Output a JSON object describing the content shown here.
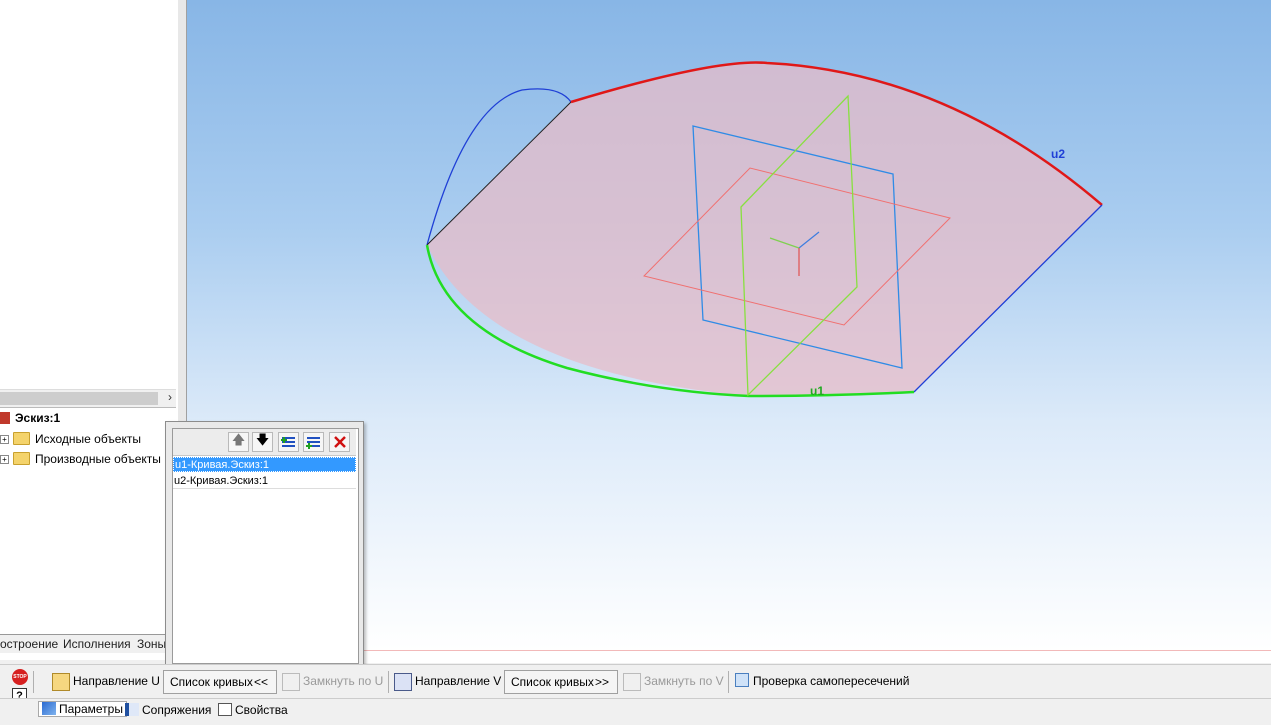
{
  "tree": {
    "root": "Эскиз:1",
    "items": [
      "Исходные объекты",
      "Производные объекты"
    ]
  },
  "left_tabs": [
    "остроение",
    "Исполнения",
    "Зоны"
  ],
  "viewport": {
    "labels": {
      "u1": "u1",
      "u2": "u2"
    },
    "colors": {
      "curve_u1": "#22dd22",
      "curve_u2": "#e01818",
      "surface_fill": "#e7bcc8",
      "edge_blue": "#1f3fd6"
    }
  },
  "curve_list": {
    "toolbar_icons": [
      "move-up-icon",
      "move-down-icon",
      "add-after-icon",
      "add-before-icon",
      "delete-icon"
    ],
    "items": [
      {
        "label": "u1-Кривая.Эскиз:1",
        "selected": true
      },
      {
        "label": "u2-Кривая.Эскиз:1",
        "selected": false
      }
    ]
  },
  "properties": {
    "direction_u": "Направление U",
    "curve_list_u": "Список кривых",
    "curve_list_u_arrow": "<<",
    "close_u": "Замкнуть по U",
    "direction_v": "Направление V",
    "curve_list_v": "Список кривых",
    "curve_list_v_arrow": ">>",
    "close_v": "Замкнуть по V",
    "self_intersection": "Проверка самопересечений"
  },
  "bottom_tabs": [
    "Параметры",
    "Сопряжения",
    "Свойства"
  ]
}
